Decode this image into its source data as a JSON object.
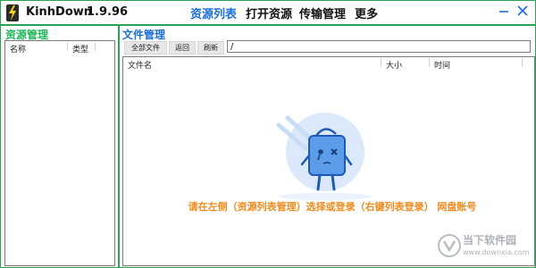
{
  "app": {
    "name": "KinhDown",
    "version": "1.9.96",
    "icon": "lightning-bolt-icon"
  },
  "menu": [
    {
      "label": "资源列表",
      "active": true
    },
    {
      "label": "打开资源",
      "active": false
    },
    {
      "label": "传输管理",
      "active": false
    },
    {
      "label": "更多",
      "active": false
    }
  ],
  "window_controls": {
    "minimize": "minimize-icon",
    "close": "close-icon"
  },
  "colors": {
    "accent_green": "#2aa352",
    "title_blue": "#1a6fd8",
    "hint_orange": "#f08a1c",
    "panel_green": "#1fb85a"
  },
  "left_panel": {
    "title": "资源管理",
    "columns": [
      "名称",
      "类型"
    ]
  },
  "right_panel": {
    "title": "文件管理",
    "toolbar": {
      "all_files": "全部文件",
      "back": "返回",
      "refresh": "刷新"
    },
    "path": "/",
    "columns": [
      "文件名",
      "大小",
      "时间"
    ],
    "empty_hint": "请在左侧（资源列表管理）选择或登录（右键列表登录） 网盘账号",
    "empty_illustration": "bag-mascot-icon"
  },
  "watermark": {
    "line1": "当下软件园",
    "line2": "www.downxia.com",
    "icon": "downxia-logo-icon"
  }
}
